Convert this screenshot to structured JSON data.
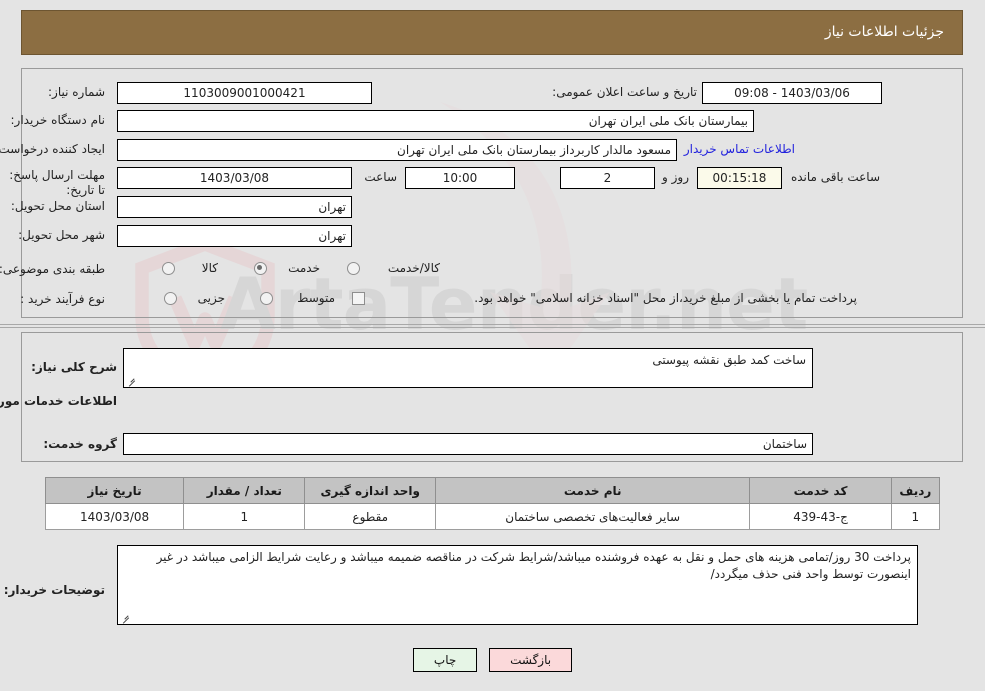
{
  "header": {
    "title": "جزئیات اطلاعات نیاز",
    "bg": "#8c6e42"
  },
  "watermark": {
    "text": "ArtaTender.net"
  },
  "form": {
    "need_number_label": "شماره نیاز:",
    "need_number_value": "1103009001000421",
    "announce_label": "تاریخ و ساعت اعلان عمومی:",
    "announce_value": "1403/03/06 - 09:08",
    "buyer_org_label": "نام دستگاه خریدار:",
    "buyer_org_value": "بیمارستان بانک ملی ایران تهران",
    "creator_label": "ایجاد کننده درخواست:",
    "creator_value": "مسعود مالدار کاربرداز بیمارستان بانک ملی ایران تهران",
    "buyer_org_extra": "بیمارستان بانک ملی ایران تهران",
    "contact_link": "اطلاعات تماس خریدار",
    "deadline_label": "مهلت ارسال پاسخ: تا تاریخ:",
    "deadline_date": "1403/03/08",
    "hour_label": "ساعت",
    "hour_value": "10:00",
    "days_value": "2",
    "days_label": "روز و",
    "countdown_value": "00:15:18",
    "remaining_label": "ساعت باقی مانده",
    "province_label": "استان محل تحویل:",
    "province_value": "تهران",
    "city_label": "شهر محل تحویل:",
    "city_value": "تهران",
    "category_label": "طبقه بندی موضوعی:",
    "category_options": [
      {
        "label": "کالا",
        "selected": false
      },
      {
        "label": "خدمت",
        "selected": true
      },
      {
        "label": "کالا/خدمت",
        "selected": false
      }
    ],
    "process_label": "نوع فرآیند خرید :",
    "process_options": [
      {
        "label": "جزیی",
        "selected": false
      },
      {
        "label": "متوسط",
        "selected": false
      }
    ],
    "treasury_note": "پرداخت تمام یا بخشی از مبلغ خرید،از محل \"اسناد خزانه اسلامی\" خواهد بود.",
    "treasury_checked": false
  },
  "description": {
    "label": "شرح کلی نیاز:",
    "value": "ساخت کمد طبق نقشه پیوستی"
  },
  "services": {
    "section_title": "اطلاعات خدمات مورد نیاز",
    "group_label": "گروه خدمت:",
    "group_value": "ساختمان"
  },
  "table": {
    "columns": [
      "ردیف",
      "کد خدمت",
      "نام خدمت",
      "واحد اندازه گیری",
      "تعداد / مقدار",
      "تاریخ نیاز"
    ],
    "rows": [
      {
        "row_no": "1",
        "service_code": "ج-43-439",
        "service_name": "سایر فعالیت‌های تخصصی ساختمان",
        "unit": "مقطوع",
        "quantity": "1",
        "need_date": "1403/03/08"
      }
    ]
  },
  "buyer_notes": {
    "label": "توضیحات خریدار:",
    "line1": "پرداخت 30 روز/تمامی هزینه های حمل و نقل به عهده فروشنده میباشد/شرایط شرکت در مناقصه ضمیمه میباشد و رعایت",
    "line2": "شرایط الزامی میباشد در غیر اینصورت توسط واحد فنی حذف میگردد/"
  },
  "buttons": {
    "print": "چاپ",
    "back": "بازگشت"
  }
}
